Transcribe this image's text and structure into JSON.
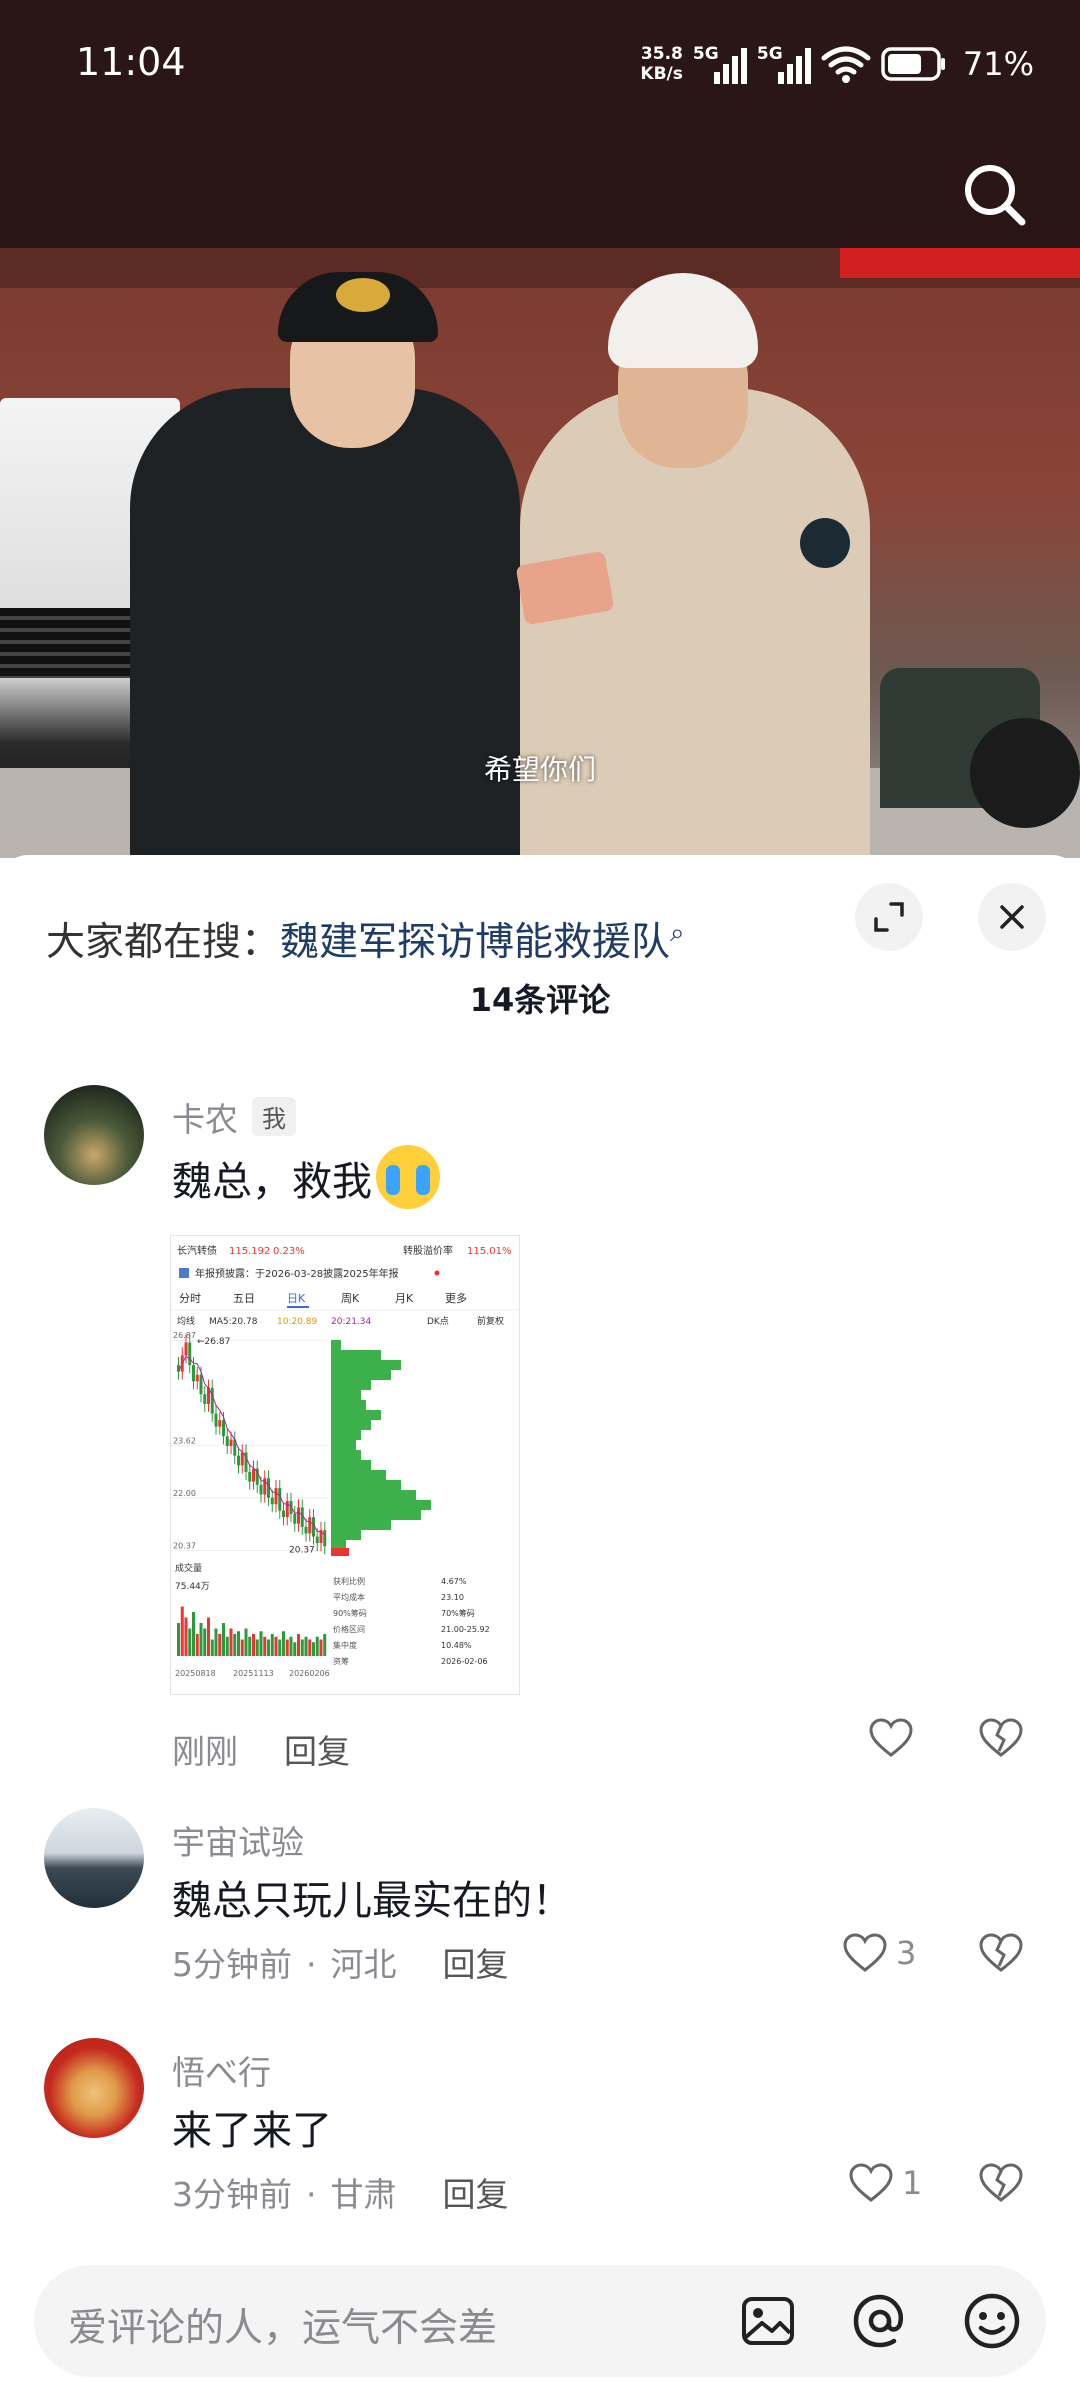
{
  "status_bar": {
    "time": "11:04",
    "net_speed_value": "35.8",
    "net_speed_unit": "KB/s",
    "sim1_label": "5G",
    "sim2_label": "5G",
    "battery": "71%",
    "battery_level": 0.71
  },
  "header": {
    "search_icon": "search-icon"
  },
  "video": {
    "subtitle": "希望你们"
  },
  "sheet": {
    "search_prefix": "大家都在搜：",
    "search_keyword": "魏建军探访博能救援队",
    "comment_count": "14条评论"
  },
  "comments": [
    {
      "username": "卡农",
      "tag": "我",
      "text": "魏总，救我",
      "emoji": "loudly-crying-face",
      "time": "刚刚",
      "reply": "回复",
      "likes": "",
      "image": {
        "name_row": "长汽转债",
        "price": "115.192",
        "change": "0.23%",
        "premium_label": "转股溢价率",
        "premium": "115.01%",
        "notice": "年报预披露：于2026-03-28披露2025年年报",
        "tabs": [
          "分时",
          "五日",
          "日K",
          "周K",
          "月K",
          "更多"
        ],
        "active_tab": "日K",
        "ma_label": "均线",
        "ma5": "MA5:20.78",
        "ma10": "10:20.89",
        "ma20": "20:21.34",
        "dk_label": "DK点",
        "fq_label": "前复权",
        "high": "26.87",
        "y_ticks": [
          "26.87",
          "23.62",
          "22.00",
          "20.37"
        ],
        "low_label": "20.37",
        "vol_label": "成交量",
        "vol_value": "75.44万",
        "dates": [
          "20250818",
          "20251113",
          "20260206"
        ],
        "stats": [
          [
            "获利比例",
            "4.67%"
          ],
          [
            "平均成本",
            "23.10"
          ],
          [
            "90%筹码",
            "70%筹码"
          ],
          [
            "价格区间",
            "21.00-25.92"
          ],
          [
            "集中度",
            "10.48%"
          ],
          [
            "资筹",
            "2026-02-06"
          ]
        ]
      }
    },
    {
      "username": "宇宙试验",
      "text": "魏总只玩儿最实在的！",
      "time": "5分钟前",
      "location": "河北",
      "reply": "回复",
      "likes": "3"
    },
    {
      "username": "悟べ行",
      "text": "来了来了",
      "time": "3分钟前",
      "location": "甘肃",
      "reply": "回复",
      "likes": "1"
    }
  ],
  "input": {
    "placeholder": "爱评论的人，运气不会差",
    "icons": [
      "image-icon",
      "at-icon",
      "emoji-icon"
    ]
  }
}
